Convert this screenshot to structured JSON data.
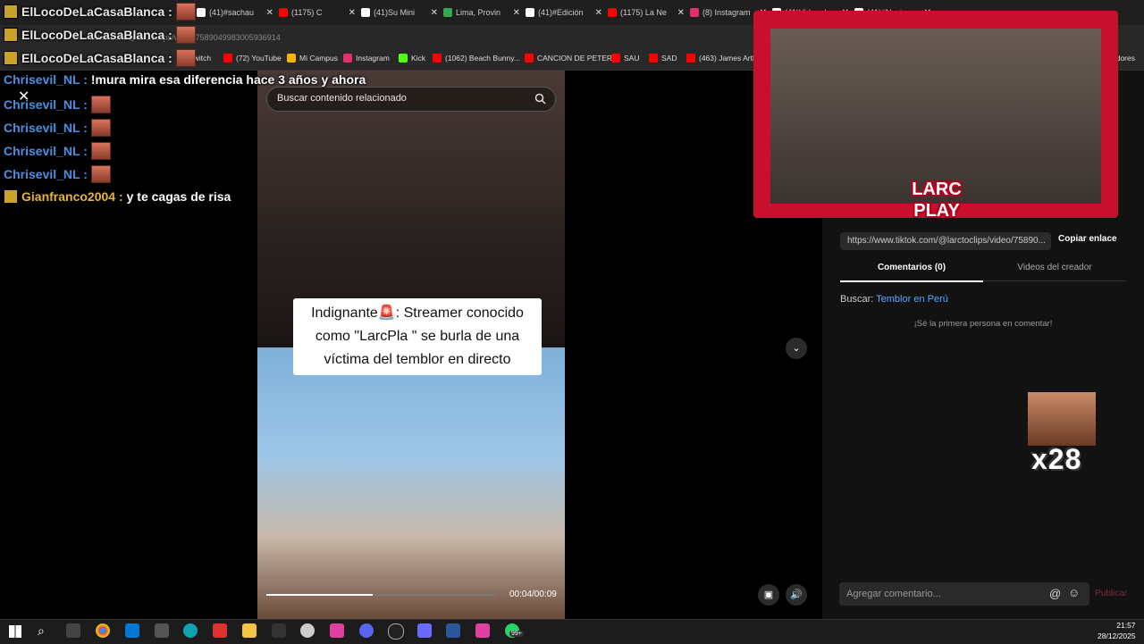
{
  "browser": {
    "tabs": [
      {
        "label": "(41)#sachau",
        "color": "#ffffff"
      },
      {
        "label": "(1175) C",
        "color": "#ff0000"
      },
      {
        "label": "(41)Su Mini",
        "color": "#ffffff"
      },
      {
        "label": "Lima, Provin",
        "color": "#34a853"
      },
      {
        "label": "(41)#Edición",
        "color": "#ffffff"
      },
      {
        "label": "(1175) La Ne",
        "color": "#ff0000"
      },
      {
        "label": "(8) Instagram",
        "color": "#e1306c"
      },
      {
        "label": "(41)Video d",
        "color": "#ffffff"
      },
      {
        "label": "(41)#Navi",
        "color": "#ffffff"
      }
    ],
    "address": "tiktok.com/@larctoclips/video/7589049983005936914",
    "bookmarks": [
      {
        "label": "Twitch",
        "color": "#9146ff"
      },
      {
        "label": "(72) YouTube",
        "color": "#ff0000"
      },
      {
        "label": "Mi Campus",
        "color": "#f4b400"
      },
      {
        "label": "Instagram",
        "color": "#e1306c"
      },
      {
        "label": "Kick",
        "color": "#53fc18"
      },
      {
        "label": "(1062) Beach Bunny...",
        "color": "#ff0000"
      },
      {
        "label": "CANCION DE PETER",
        "color": "#ff0000"
      },
      {
        "label": "SAU",
        "color": "#ff0000"
      },
      {
        "label": "SAD",
        "color": "#ff0000"
      },
      {
        "label": "(463) James Arthur",
        "color": "#ff0000"
      },
      {
        "label": "adores",
        "color": "#888888"
      }
    ]
  },
  "chat": [
    {
      "user": "ElLocoDeLaCasaBlanca",
      "msg": "",
      "emote": true,
      "badge": true,
      "user_color": "#e8e8e8"
    },
    {
      "user": "ElLocoDeLaCasaBlanca",
      "msg": "",
      "emote": true,
      "badge": true,
      "user_color": "#e8e8e8"
    },
    {
      "user": "ElLocoDeLaCasaBlanca",
      "msg": "",
      "emote": true,
      "badge": true,
      "user_color": "#e8e8e8"
    },
    {
      "user": "Chrisevil_NL",
      "msg": "!mura mira esa diferencia hace 3 años y ahora",
      "emote": false,
      "badge": false,
      "user_color": "#4a8fe0"
    },
    {
      "user": "Chrisevil_NL",
      "msg": "",
      "emote": true,
      "badge": false,
      "user_color": "#4a8fe0"
    },
    {
      "user": "Chrisevil_NL",
      "msg": "",
      "emote": true,
      "badge": false,
      "user_color": "#4a8fe0"
    },
    {
      "user": "Chrisevil_NL",
      "msg": "",
      "emote": true,
      "badge": false,
      "user_color": "#4a8fe0"
    },
    {
      "user": "Chrisevil_NL",
      "msg": "",
      "emote": true,
      "badge": false,
      "user_color": "#4a8fe0"
    },
    {
      "user": "Gianfranco2004",
      "msg": "y te cagas de risa",
      "emote": false,
      "badge": true,
      "user_color": "#e8b33a"
    }
  ],
  "video": {
    "search_placeholder": "Buscar contenido relacionado",
    "caption_line1": "Indignante🚨: Streamer conocido",
    "caption_line2": "como \"LarcPla \" se burla de una",
    "caption_line3": "víctima del temblor en directo",
    "timecode": "00:04/00:09",
    "progress": 0.46
  },
  "webcam": {
    "logo_line1": "LARC",
    "logo_line2": "PLAY"
  },
  "panel": {
    "link": "https://www.tiktok.com/@larctoclips/video/75890...",
    "copy_link": "Copiar enlace",
    "tab_comments": "Comentarios (0)",
    "tab_creator": "Videos del creador",
    "search_label": "Buscar:",
    "search_term": "Temblor en Perú",
    "first_comment": "¡Sé la primera persona en comentar!",
    "emote_count": "x28",
    "add_comment": "Agregar comentario...",
    "publish": "Publicar"
  },
  "taskbar": {
    "time": "21:57",
    "date": "28/12/2025",
    "badge": "99+"
  }
}
